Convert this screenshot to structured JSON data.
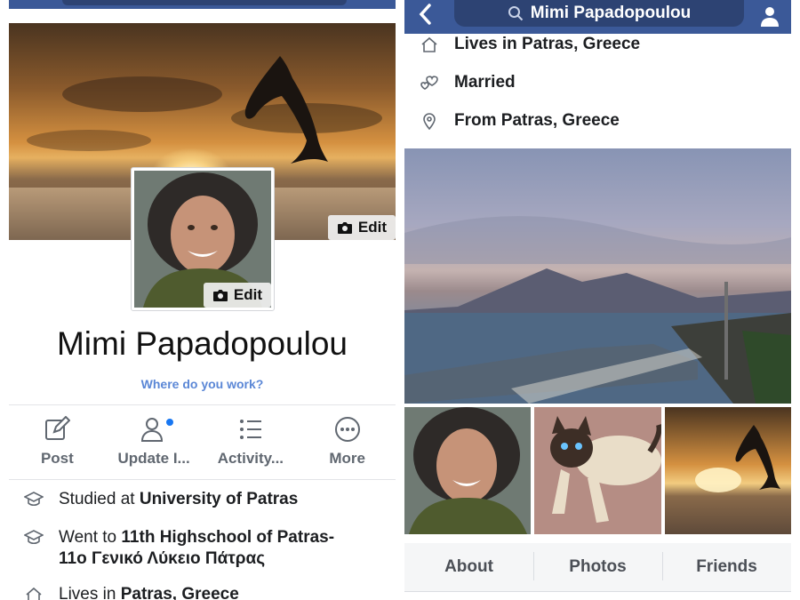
{
  "left": {
    "cover_edit_label": "Edit",
    "avatar_edit_label": "Edit",
    "profile_name": "Mimi Papadopoulou",
    "work_prompt": "Where do you work?",
    "actions": [
      {
        "label": "Post",
        "icon": "compose-icon"
      },
      {
        "label": "Update I...",
        "icon": "update-info-icon"
      },
      {
        "label": "Activity...",
        "icon": "activity-log-icon"
      },
      {
        "label": "More",
        "icon": "more-icon"
      }
    ],
    "intro": [
      {
        "prefix": "Studied at ",
        "bold": "University of Patras",
        "icon": "graduation-cap-icon"
      },
      {
        "prefix": "Went to ",
        "bold": "11th Highschool of Patras-11ο Γενικό Λύκειο Πάτρας",
        "icon": "graduation-cap-icon"
      },
      {
        "prefix": "Lives in ",
        "bold": "Patras, Greece",
        "icon": "home-icon"
      }
    ]
  },
  "right": {
    "search_value": "Mimi Papadopoulou",
    "info": [
      {
        "prefix": "Lives in Patras, Greece",
        "icon": "home-icon"
      },
      {
        "prefix": "Married",
        "icon": "heart-icon"
      },
      {
        "prefix": "From Patras, Greece",
        "icon": "location-pin-icon"
      }
    ],
    "tabs": [
      "About",
      "Photos",
      "Friends"
    ]
  },
  "colors": {
    "brand": "#3b5998",
    "link": "#5b87d6",
    "notification_dot": "#1877f2"
  }
}
